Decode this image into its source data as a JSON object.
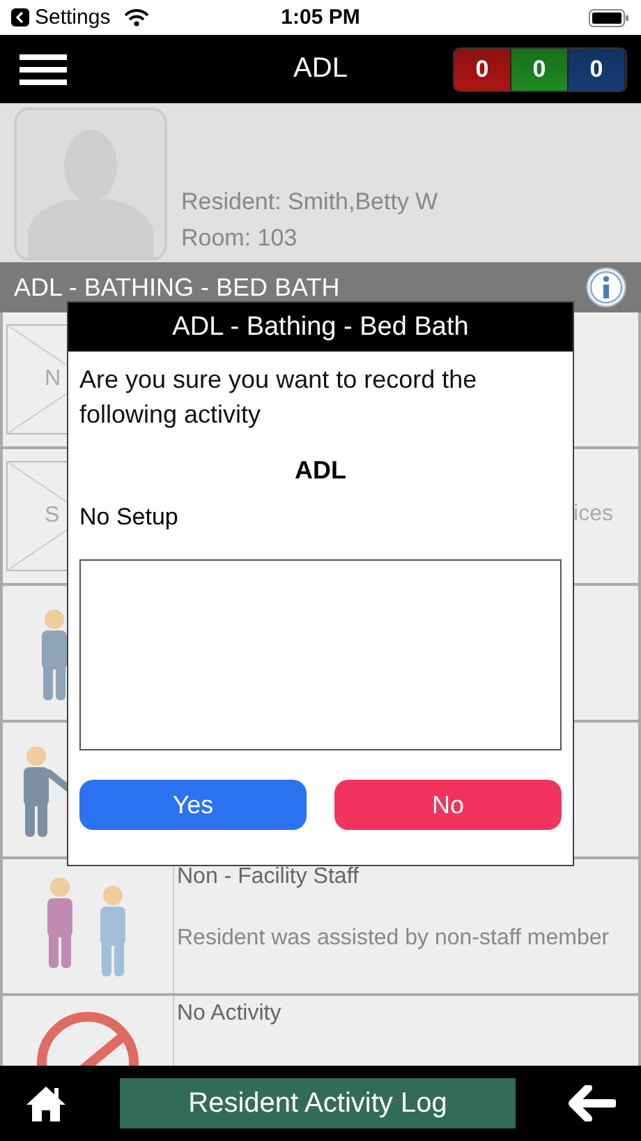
{
  "status_bar": {
    "back_label": "Settings",
    "time": "1:05 PM"
  },
  "header": {
    "title": "ADL",
    "counters": [
      {
        "value": "0",
        "color": "#b01414"
      },
      {
        "value": "0",
        "color": "#1f8a22"
      },
      {
        "value": "0",
        "color": "#163d78"
      }
    ]
  },
  "resident": {
    "name": "Resident: Smith,Betty W",
    "room": "Room: 103"
  },
  "section_title": "ADL - BATHING - BED BATH",
  "rows": [
    {
      "kind": "placeholder",
      "left_text": "N"
    },
    {
      "kind": "placeholder",
      "left_text": "S",
      "right_text": "ices"
    },
    {
      "kind": "staff"
    },
    {
      "kind": "staff-assist"
    },
    {
      "kind": "pair",
      "title": "Non - Facility Staff",
      "description": "Resident was assisted by non-staff member"
    },
    {
      "kind": "none",
      "title": "No Activity"
    }
  ],
  "dialog": {
    "title": "ADL - Bathing - Bed Bath",
    "message": "Are you sure you want to record the following activity",
    "activity": "ADL",
    "setup": "No Setup",
    "buttons": [
      {
        "label": "Yes",
        "kind": "confirm"
      },
      {
        "label": "No",
        "kind": "cancel"
      }
    ]
  },
  "bottom_bar": {
    "title": "Resident Activity Log"
  }
}
